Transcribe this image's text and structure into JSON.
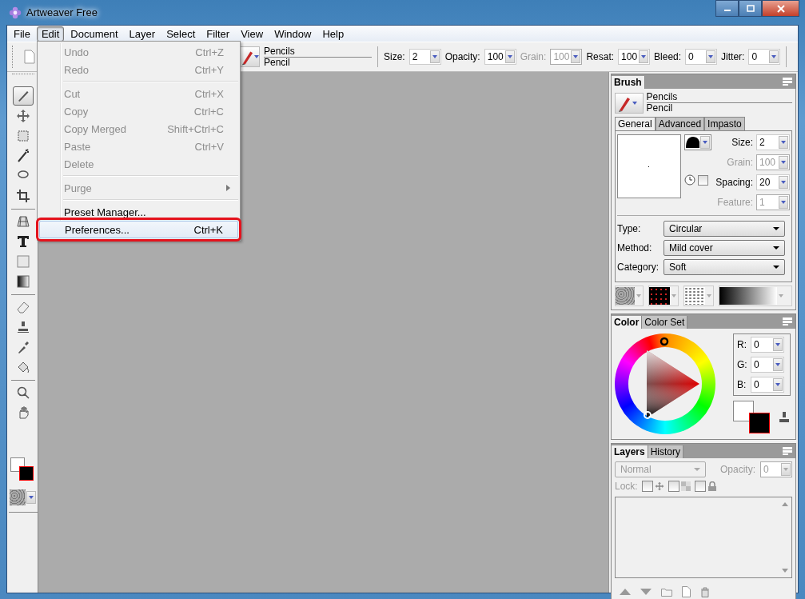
{
  "window": {
    "title": "Artweaver Free"
  },
  "menu_bar": [
    {
      "label": "File",
      "selected": false
    },
    {
      "label": "Edit",
      "selected": true
    },
    {
      "label": "Document",
      "selected": false
    },
    {
      "label": "Layer",
      "selected": false
    },
    {
      "label": "Select",
      "selected": false
    },
    {
      "label": "Filter",
      "selected": false
    },
    {
      "label": "View",
      "selected": false
    },
    {
      "label": "Window",
      "selected": false
    },
    {
      "label": "Help",
      "selected": false
    }
  ],
  "edit_menu": [
    {
      "kind": "item",
      "label": "Undo",
      "shortcut": "Ctrl+Z",
      "disabled": true,
      "highlighted": false
    },
    {
      "kind": "item",
      "label": "Redo",
      "shortcut": "Ctrl+Y",
      "disabled": true,
      "highlighted": false
    },
    {
      "kind": "separator"
    },
    {
      "kind": "item",
      "label": "Cut",
      "shortcut": "Ctrl+X",
      "disabled": true,
      "highlighted": false
    },
    {
      "kind": "item",
      "label": "Copy",
      "shortcut": "Ctrl+C",
      "disabled": true,
      "highlighted": false
    },
    {
      "kind": "item",
      "label": "Copy Merged",
      "shortcut": "Shift+Ctrl+C",
      "disabled": true,
      "highlighted": false
    },
    {
      "kind": "item",
      "label": "Paste",
      "shortcut": "Ctrl+V",
      "disabled": true,
      "highlighted": false
    },
    {
      "kind": "item",
      "label": "Delete",
      "disabled": true,
      "highlighted": false
    },
    {
      "kind": "separator"
    },
    {
      "kind": "submenu",
      "label": "Purge",
      "disabled": true,
      "highlighted": false
    },
    {
      "kind": "separator"
    },
    {
      "kind": "item",
      "label": "Preset Manager...",
      "disabled": false,
      "highlighted": false
    },
    {
      "kind": "item",
      "label": "Preferences...",
      "shortcut": "Ctrl+K",
      "disabled": false,
      "highlighted": true
    }
  ],
  "toolbar": {
    "brush_category": "Pencils",
    "brush_name": "Pencil",
    "fields": [
      {
        "label": "Size:",
        "value": "2",
        "disabled": false
      },
      {
        "label": "Opacity:",
        "value": "100",
        "disabled": false
      },
      {
        "label": "Grain:",
        "value": "100",
        "disabled": true
      },
      {
        "label": "Resat:",
        "value": "100",
        "disabled": false
      },
      {
        "label": "Bleed:",
        "value": "0",
        "disabled": false
      },
      {
        "label": "Jitter:",
        "value": "0",
        "disabled": false
      }
    ]
  },
  "tool_groups": [
    [
      {
        "kind": "brush",
        "selected": true
      },
      {
        "kind": "move",
        "selected": false
      },
      {
        "kind": "marquee",
        "selected": false
      },
      {
        "kind": "wand",
        "selected": false
      },
      {
        "kind": "lasso",
        "selected": false
      },
      {
        "kind": "crop",
        "selected": false
      }
    ],
    [
      {
        "kind": "perspective",
        "selected": false
      },
      {
        "kind": "text",
        "selected": false
      },
      {
        "kind": "shape",
        "selected": false
      },
      {
        "kind": "gradient",
        "selected": false
      }
    ],
    [
      {
        "kind": "eraser",
        "selected": false
      },
      {
        "kind": "stamp",
        "selected": false
      },
      {
        "kind": "eyedropper",
        "selected": false
      },
      {
        "kind": "bucket",
        "selected": false
      }
    ],
    [
      {
        "kind": "zoom",
        "selected": false
      },
      {
        "kind": "hand",
        "selected": false
      }
    ]
  ],
  "brush_panel": {
    "title": "Brush",
    "category": "Pencils",
    "name": "Pencil",
    "tabs": [
      {
        "label": "General",
        "selected": true
      },
      {
        "label": "Advanced",
        "selected": false
      },
      {
        "label": "Impasto",
        "selected": false
      }
    ],
    "fields": [
      {
        "label": "Size:",
        "value": "2",
        "disabled": false
      },
      {
        "label": "Grain:",
        "value": "100",
        "disabled": true
      },
      {
        "label": "Spacing:",
        "value": "20",
        "disabled": false
      },
      {
        "label": "Feature:",
        "value": "1",
        "disabled": true
      }
    ],
    "jitter_checkbox": {
      "checked": false
    },
    "selects": [
      {
        "label": "Type:",
        "value": "Circular"
      },
      {
        "label": "Method:",
        "value": "Mild cover"
      },
      {
        "label": "Category:",
        "value": "Soft"
      }
    ]
  },
  "color_panel": {
    "tabs": [
      {
        "label": "Color",
        "selected": true
      },
      {
        "label": "Color Set",
        "selected": false
      }
    ],
    "channels": [
      {
        "label": "R:",
        "value": "0"
      },
      {
        "label": "G:",
        "value": "0"
      },
      {
        "label": "B:",
        "value": "0"
      }
    ]
  },
  "layers_panel": {
    "tabs": [
      {
        "label": "Layers",
        "selected": true
      },
      {
        "label": "History",
        "selected": false
      }
    ],
    "blend_mode": "Normal",
    "opacity_label": "Opacity:",
    "opacity": "0",
    "lock_label": "Lock:",
    "locks": [
      {
        "kind": "position",
        "checked": false
      },
      {
        "kind": "transparency",
        "checked": false
      },
      {
        "kind": "all",
        "checked": false
      }
    ]
  }
}
